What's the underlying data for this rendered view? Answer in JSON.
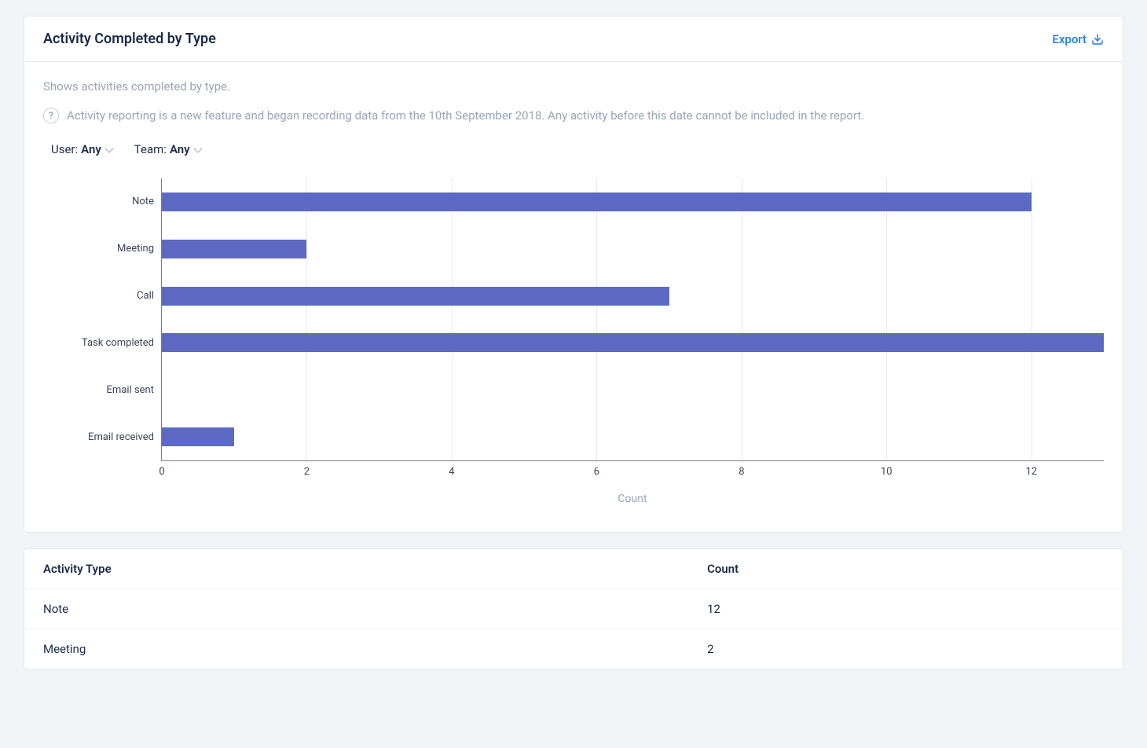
{
  "header": {
    "title": "Activity Completed by Type",
    "export_label": "Export"
  },
  "subtitle": "Shows activities completed by type.",
  "info_text": "Activity reporting is a new feature and began recording data from the 10th September 2018. Any activity before this date cannot be included in the report.",
  "filters": {
    "user": {
      "label": "User:",
      "value": "Any"
    },
    "team": {
      "label": "Team:",
      "value": "Any"
    }
  },
  "chart_data": {
    "type": "bar",
    "orientation": "horizontal",
    "categories": [
      "Note",
      "Meeting",
      "Call",
      "Task completed",
      "Email sent",
      "Email received"
    ],
    "values": [
      12,
      2,
      7,
      13,
      0,
      1
    ],
    "xlabel": "Count",
    "xticks": [
      0,
      2,
      4,
      6,
      8,
      10,
      12
    ],
    "xlim": [
      0,
      13
    ],
    "bar_color": "#5c6ac4"
  },
  "table": {
    "columns": [
      "Activity Type",
      "Count"
    ],
    "rows": [
      {
        "type": "Note",
        "count": "12"
      },
      {
        "type": "Meeting",
        "count": "2"
      }
    ]
  }
}
